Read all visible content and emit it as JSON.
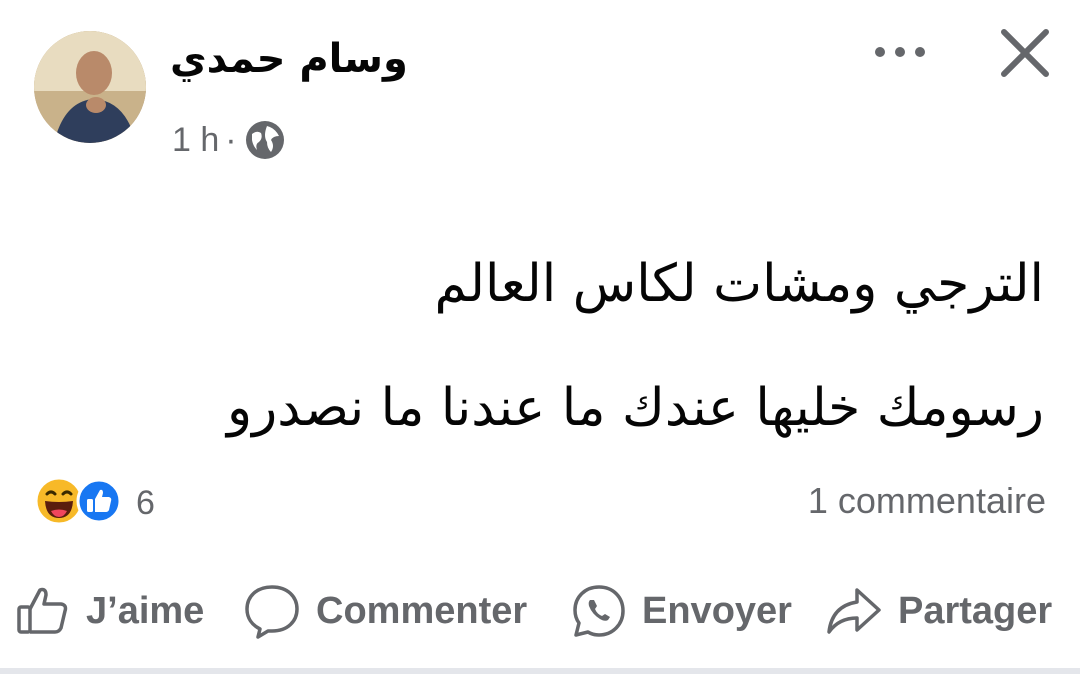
{
  "post": {
    "author": "وسام حمدي",
    "time": "1 h",
    "separator": "·",
    "privacy_icon": "globe-icon",
    "text_lines": [
      "الترجي ومشات لكاس العالم",
      "رسومك خليها عندك ما عندنا ما نصدرو"
    ]
  },
  "header_icons": {
    "more": "more-options-icon",
    "close": "close-icon"
  },
  "reactions": {
    "icons": [
      "haha-reaction-icon",
      "like-reaction-icon"
    ],
    "count": "6"
  },
  "comments_count_label": "1 commentaire",
  "actions": {
    "like": "J’aime",
    "comment": "Commenter",
    "send": "Envoyer",
    "share": "Partager"
  },
  "colors": {
    "secondary_text": "#65676b",
    "like_blue": "#1877f2",
    "haha_yellow": "#f7b928"
  }
}
